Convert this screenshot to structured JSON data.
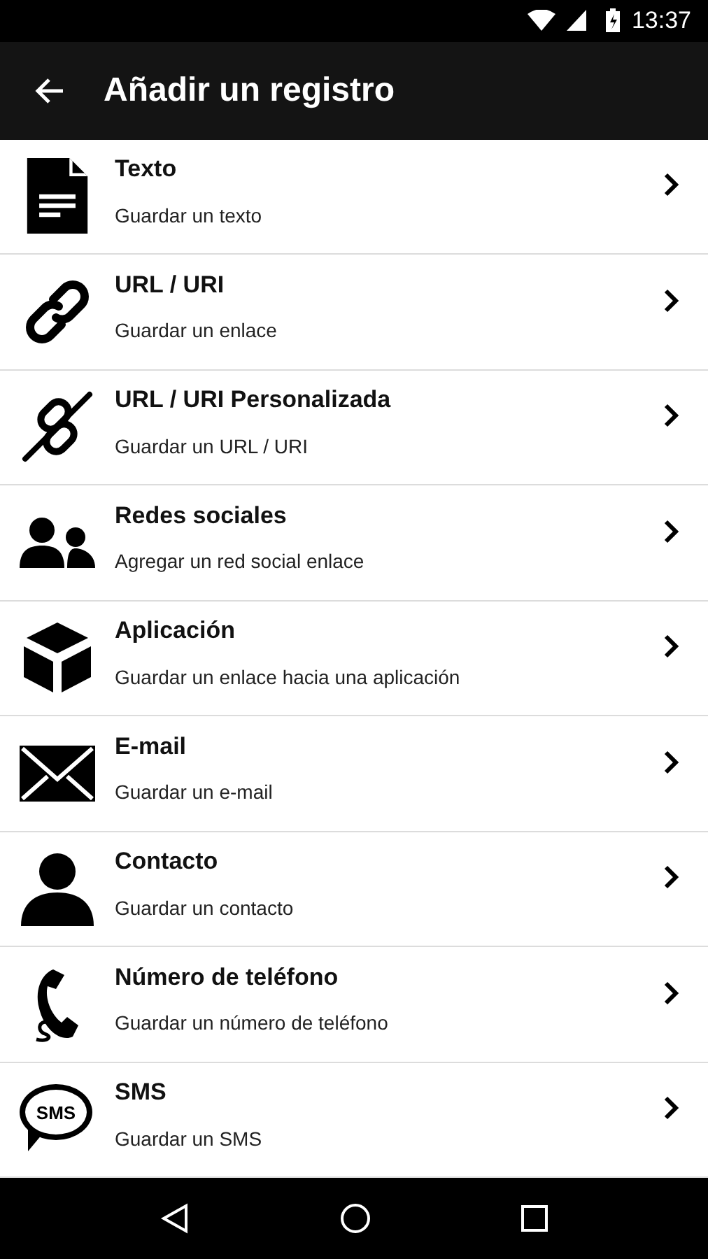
{
  "status_bar": {
    "time": "13:37"
  },
  "toolbar": {
    "title": "Añadir un registro"
  },
  "items": [
    {
      "kind": "text",
      "title": "Texto",
      "subtitle": "Guardar un texto"
    },
    {
      "kind": "link",
      "title": "URL / URI",
      "subtitle": "Guardar un enlace"
    },
    {
      "kind": "custom-link",
      "title": "URL / URI Personalizada",
      "subtitle": "Guardar un URL / URI"
    },
    {
      "kind": "social",
      "title": "Redes sociales",
      "subtitle": "Agregar un red social enlace"
    },
    {
      "kind": "app",
      "title": "Aplicación",
      "subtitle": "Guardar un enlace hacia una aplicación"
    },
    {
      "kind": "email",
      "title": "E-mail",
      "subtitle": "Guardar un e-mail"
    },
    {
      "kind": "contact",
      "title": "Contacto",
      "subtitle": "Guardar un contacto"
    },
    {
      "kind": "phone",
      "title": "Número de teléfono",
      "subtitle": "Guardar un número de teléfono"
    },
    {
      "kind": "sms",
      "title": "SMS",
      "subtitle": "Guardar un SMS",
      "icon_label": "SMS"
    }
  ]
}
